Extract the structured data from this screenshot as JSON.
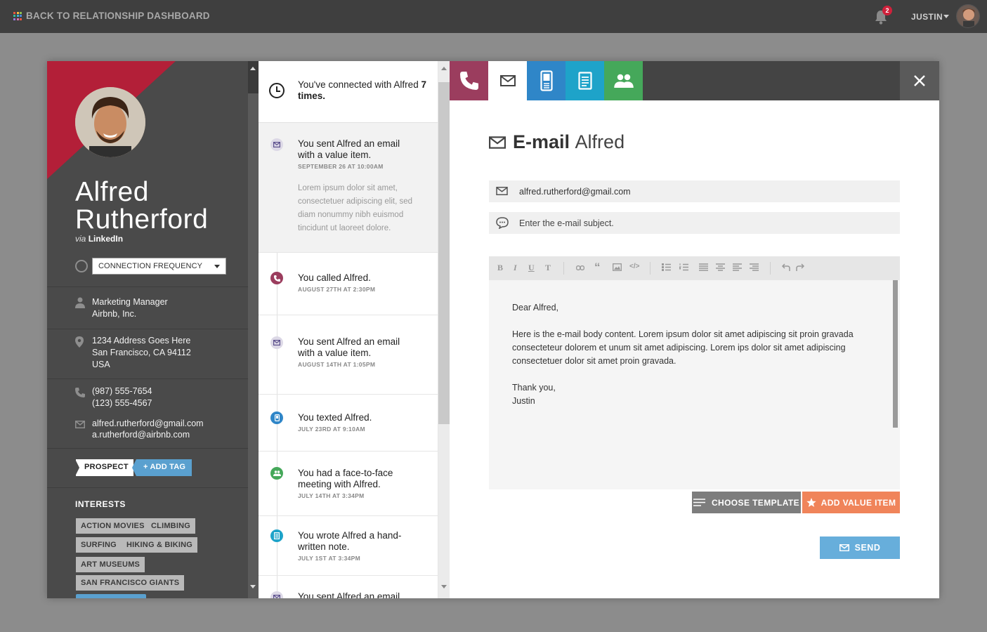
{
  "topbar": {
    "back_label": "BACK TO RELATIONSHIP DASHBOARD",
    "notifications_count": "2",
    "user_name": "JUSTIN"
  },
  "profile": {
    "first_name": "Alfred",
    "last_name": "Rutherford",
    "via_prefix": "via",
    "via_source": "LinkedIn",
    "frequency_label": "CONNECTION FREQUENCY",
    "job_title": "Marketing Manager",
    "company": "Airbnb, Inc.",
    "address_line1": "1234 Address Goes Here",
    "address_line2": "San Francisco, CA 94112",
    "address_line3": "USA",
    "phone1": "(987) 555-7654",
    "phone2": "(123) 555-4567",
    "email1": "alfred.rutherford@gmail.com",
    "email2": "a.rutherford@airbnb.com",
    "tag": "PROSPECT",
    "add_tag_label": "+ ADD TAG",
    "interests_title": "INTERESTS",
    "interests": [
      "ACTION MOVIES",
      "CLIMBING",
      "SURFING",
      "HIKING & BIKING",
      "ART MUSEUMS",
      "SAN FRANCISCO GIANTS"
    ]
  },
  "timeline": {
    "header_prefix": "You've connected with Alfred ",
    "header_count": "7 times.",
    "items": [
      {
        "type": "email",
        "title": "You sent Alfred an email with a value item.",
        "date": "SEPTEMBER 26 AT 10:00AM",
        "body": "Lorem ipsum dolor sit amet, consectetuer adipiscing elit, sed diam nonummy nibh euismod tincidunt ut laoreet dolore."
      },
      {
        "type": "call",
        "title": "You called Alfred.",
        "date": "AUGUST 27TH AT 2:30PM"
      },
      {
        "type": "email",
        "title": "You sent Alfred an email with a value item.",
        "date": "AUGUST 14TH AT 1:05PM"
      },
      {
        "type": "text",
        "title": "You texted Alfred.",
        "date": "JULY 23RD AT 9:10AM"
      },
      {
        "type": "meeting",
        "title": "You had a face-to-face meeting with Alfred.",
        "date": "JULY 14TH AT 3:34PM"
      },
      {
        "type": "note",
        "title": "You wrote Alfred a hand-written note.",
        "date": "JULY 1ST AT 3:34PM"
      },
      {
        "type": "email",
        "title": "You sent Alfred an email"
      }
    ]
  },
  "compose": {
    "title_bold": "E-mail",
    "title_name": "Alfred",
    "to_value": "alfred.rutherford@gmail.com",
    "subject_placeholder": "Enter the e-mail subject.",
    "body_greeting": "Dear Alfred,",
    "body_content": "Here is the e-mail body content. Lorem ipsum dolor sit amet adipiscing sit proin gravada consecteteur dolorem et unum sit amet adipiscing. Lorem ips dolor sit amet adipiscing consectetuer dolor sit amet proin gravada.",
    "body_closing": "Thank you,",
    "body_signature": "Justin",
    "choose_template_label": "CHOOSE TEMPLATE",
    "add_value_label": "ADD VALUE ITEM",
    "send_label": "SEND"
  },
  "colors": {
    "accent_red": "#b31f38",
    "call_tab": "#9b3d5e",
    "text_tab": "#2f86c8",
    "note_tab": "#1ea3c9",
    "meeting_tab": "#45a85a",
    "value_orange": "#f0845a",
    "send_blue": "#67aedb"
  }
}
